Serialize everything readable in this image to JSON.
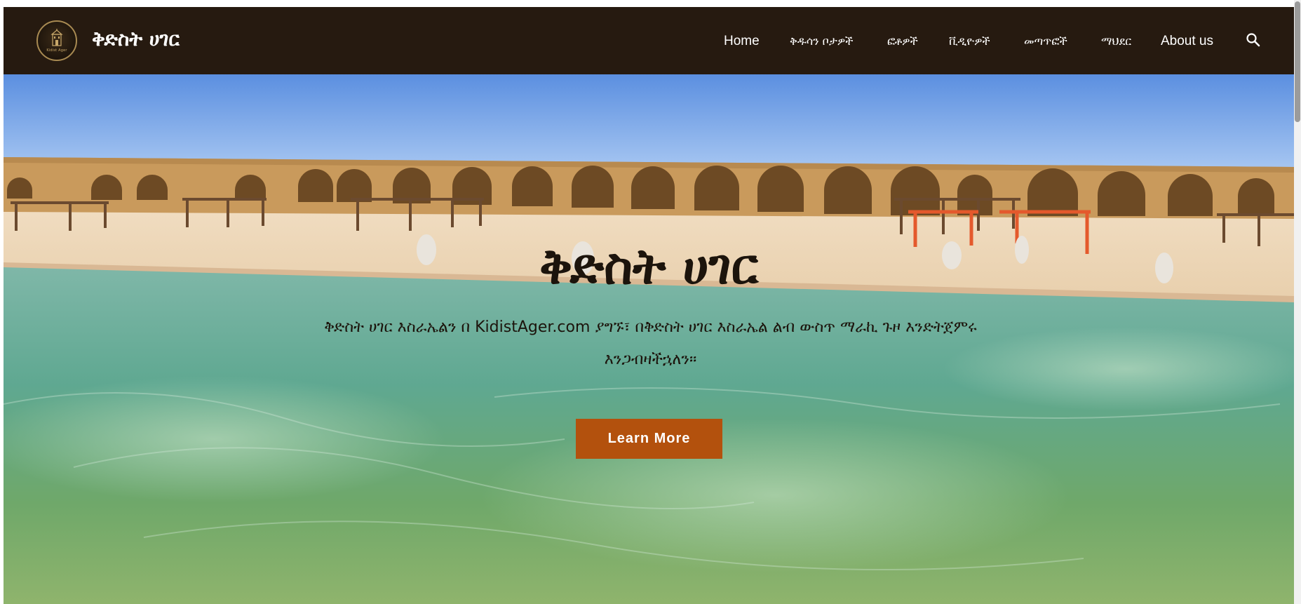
{
  "header": {
    "logo_text": "Kidist Ager",
    "site_title": "ቅድስት ሀገር"
  },
  "nav": {
    "items": [
      {
        "label": "Home"
      },
      {
        "label": "ቅዱሳን ቦታዎች"
      },
      {
        "label": "ፎቶዎች"
      },
      {
        "label": "ቪዲዮዎች"
      },
      {
        "label": "መጣጥፎች"
      },
      {
        "label": "ማህደር"
      },
      {
        "label": "About us"
      }
    ],
    "search_icon": "search-icon"
  },
  "hero": {
    "title": "ቅድስት ሀገር",
    "text": "ቅድስት ሀገር እስራኤልን በ KidistAger.com ያግኙ፣ በቅድስት ሀገር እስራኤል ልብ ውስጥ ማራኪ ጉዞ እንድትጀምሩ እንጋብዛችኋለን።",
    "cta_label": "Learn More"
  },
  "colors": {
    "header_bg": "#261a10",
    "cta_bg": "#b3510d",
    "title_color": "#1c140c"
  }
}
